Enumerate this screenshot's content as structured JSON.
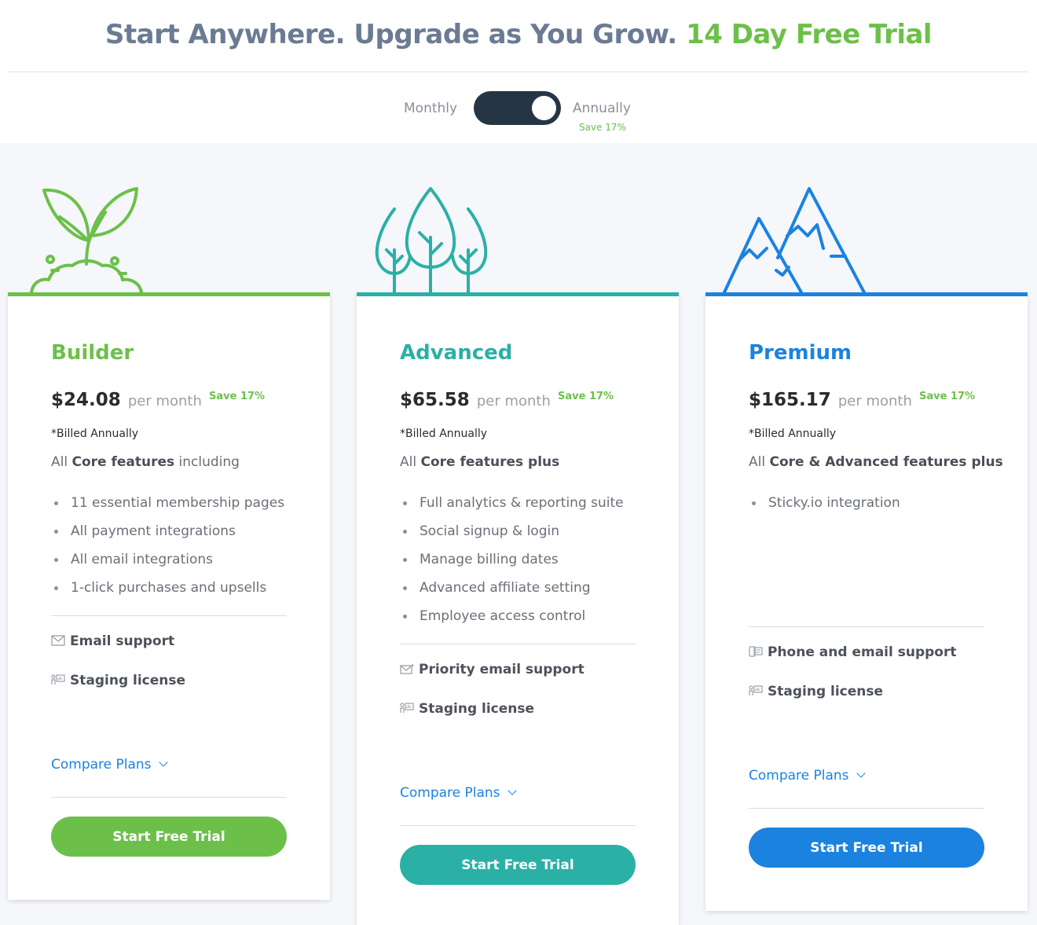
{
  "header": {
    "headline_main": "Start Anywhere. Upgrade as You Grow.",
    "headline_accent": "14 Day Free Trial"
  },
  "billing_toggle": {
    "monthly_label": "Monthly",
    "annual_label": "Annually",
    "annual_save": "Save 17%",
    "selected": "Annually"
  },
  "colors": {
    "builder": "#6cc04a",
    "advanced": "#2bb0a6",
    "premium": "#1b82e0",
    "toggle_bg": "#263544"
  },
  "plans": [
    {
      "name": "Builder",
      "illustration": "sprout-icon",
      "price": "$24.08",
      "per": "per month",
      "save": "Save 17%",
      "billed": "*Billed Annually",
      "intro_pre": "All ",
      "intro_bold": "Core features",
      "intro_post": " including",
      "features": [
        "11 essential membership pages",
        "All payment integrations",
        "All email integrations",
        "1-click purchases and upsells"
      ],
      "support": [
        "Email support",
        "Staging license"
      ],
      "compare": "Compare Plans",
      "cta": "Start Free Trial"
    },
    {
      "name": "Advanced",
      "illustration": "trees-icon",
      "price": "$65.58",
      "per": "per month",
      "save": "Save 17%",
      "billed": "*Billed Annually",
      "intro_pre": "All ",
      "intro_bold": "Core features plus",
      "intro_post": "",
      "features": [
        "Full analytics & reporting suite",
        "Social signup & login",
        "Manage billing dates",
        "Advanced affiliate setting",
        "Employee access control"
      ],
      "support": [
        "Priority email support",
        "Staging license"
      ],
      "compare": "Compare Plans",
      "cta": "Start Free Trial"
    },
    {
      "name": "Premium",
      "illustration": "mountains-icon",
      "price": "$165.17",
      "per": "per month",
      "save": "Save 17%",
      "billed": "*Billed Annually",
      "intro_pre": "All ",
      "intro_bold": "Core & Advanced features plus",
      "intro_post": "",
      "features": [
        "Sticky.io integration"
      ],
      "support": [
        "Phone and email support",
        "Staging license"
      ],
      "compare": "Compare Plans",
      "cta": "Start Free Trial"
    }
  ]
}
